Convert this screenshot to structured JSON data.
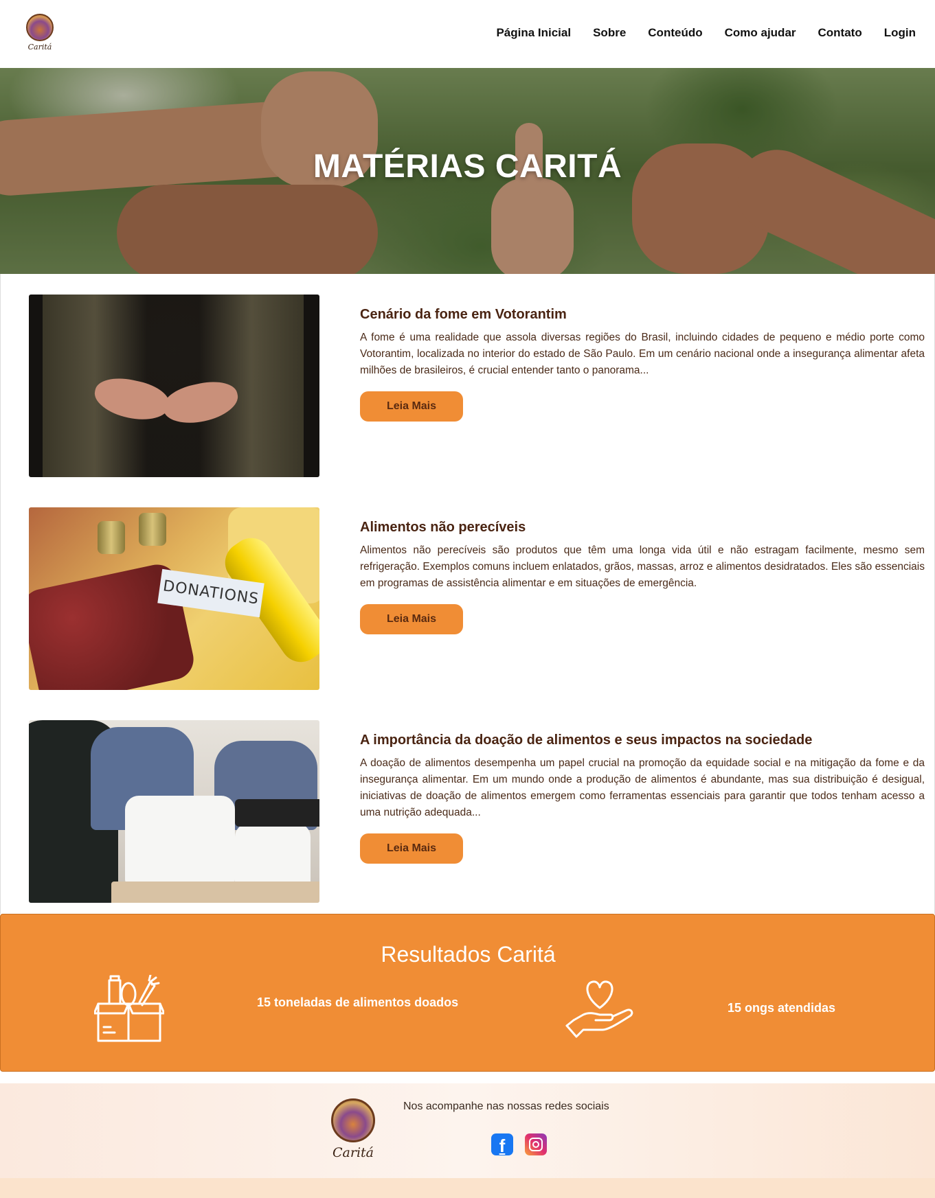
{
  "header": {
    "logo_text": "Caritá",
    "nav": [
      "Página Inicial",
      "Sobre",
      "Conteúdo",
      "Como ajudar",
      "Contato",
      "Login"
    ]
  },
  "hero": {
    "title": "MATÉRIAS CARITÁ"
  },
  "articles": [
    {
      "title": "Cenário da fome em Votorantim",
      "text": "A fome é uma realidade que assola diversas regiões do Brasil, incluindo cidades de pequeno e médio porte como Votorantim, localizada no interior do estado de São Paulo. Em um cenário nacional onde a insegurança alimentar afeta milhões de brasileiros, é crucial entender tanto o panorama...",
      "button": "Leia Mais"
    },
    {
      "title": "Alimentos não perecíveis",
      "text": "Alimentos não perecíveis são produtos que têm uma longa vida útil e não estragam facilmente, mesmo sem refrigeração. Exemplos comuns incluem enlatados, grãos, massas, arroz e alimentos desidratados. Eles são essenciais em programas de assistência alimentar e em situações de emergência.",
      "button": "Leia Mais",
      "image_label": "DONATIONS"
    },
    {
      "title": "A importância da doação de alimentos e seus impactos na sociedade",
      "text": "A doação de alimentos desempenha um papel crucial na promoção da equidade social e na mitigação da fome e da insegurança alimentar. Em um mundo onde a produção de alimentos é abundante, mas sua distribuição é desigual, iniciativas de doação de alimentos emergem como ferramentas essenciais para garantir que todos tenham acesso a uma nutrição adequada...",
      "button": "Leia Mais"
    }
  ],
  "results": {
    "title": "Resultados Caritá",
    "stat1": "15 toneladas de alimentos doados",
    "stat2": "15 ongs atendidas",
    "icon1": "food-box-icon",
    "icon2": "heart-hand-icon"
  },
  "footer": {
    "logo_text": "Caritá",
    "follow_text": "Nos acompanhe nas nossas redes sociais",
    "facebook_glyph": "f",
    "social": [
      "facebook-icon",
      "instagram-icon"
    ]
  },
  "colors": {
    "accent": "#f08d35",
    "heading": "#4a2412",
    "facebook": "#1877f2"
  }
}
